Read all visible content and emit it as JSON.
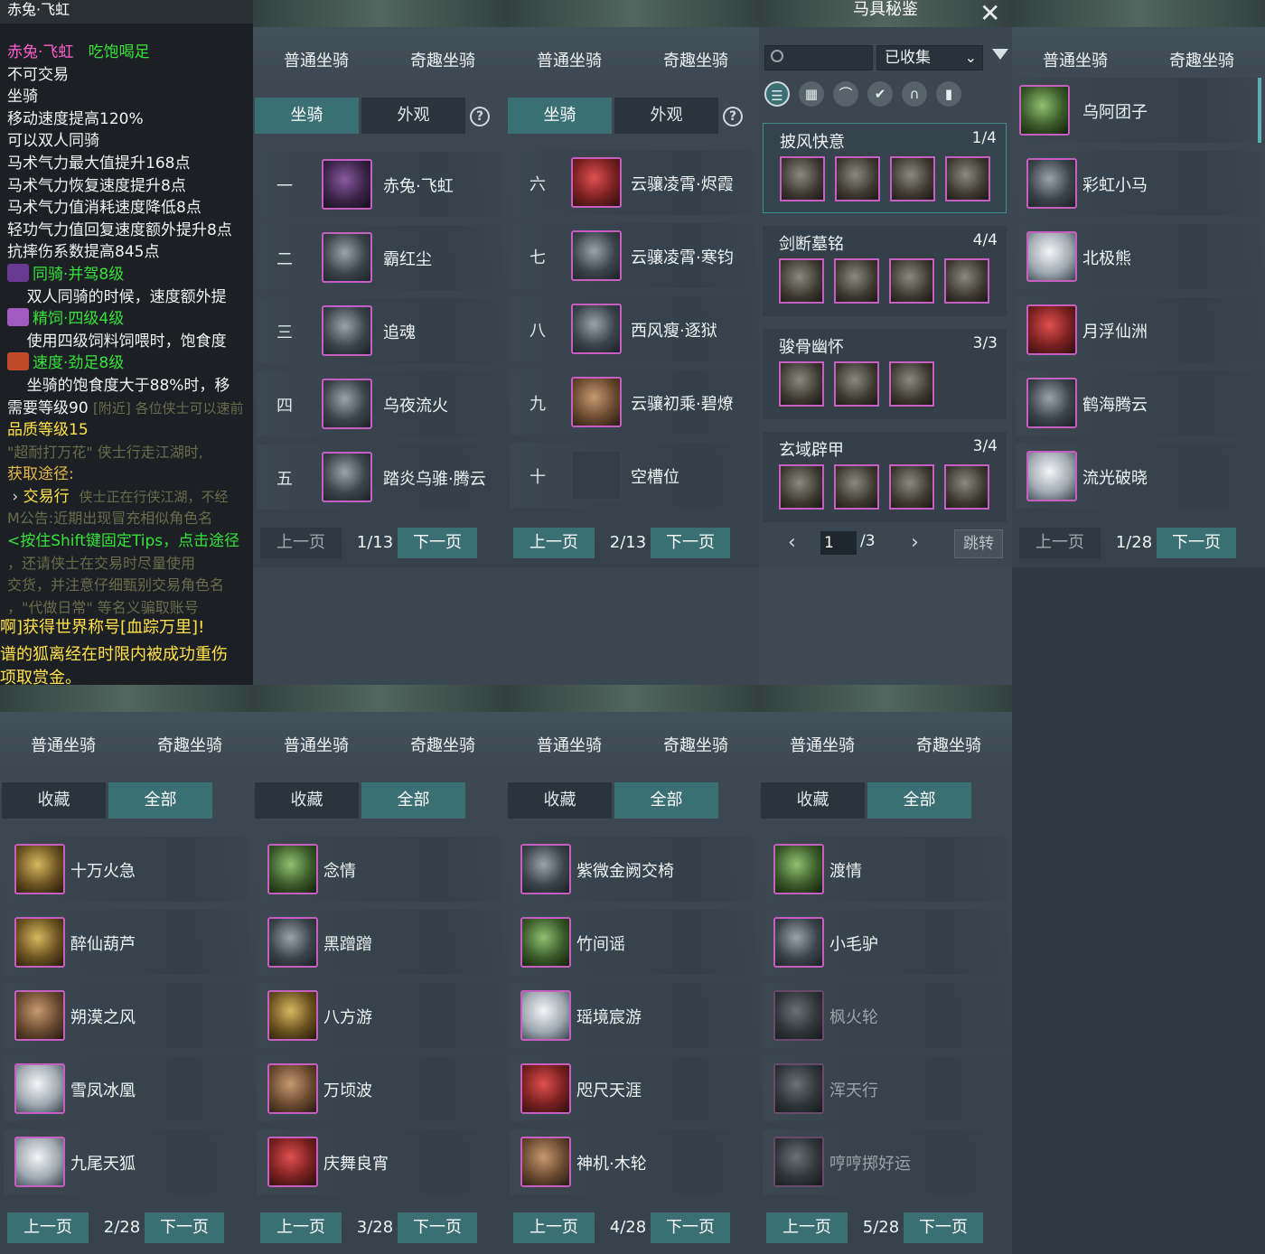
{
  "tooltip": {
    "header": "赤兔·飞虹",
    "name": "赤兔·飞虹",
    "state": "吃饱喝足",
    "trade": "不可交易",
    "kind": "坐骑",
    "lines": [
      "移动速度提高120%",
      "可以双人同骑",
      "马术气力最大值提升168点",
      "马术气力恢复速度提升8点",
      "马术气力值消耗速度降低8点",
      "轻功气力值回复速度额外提升8点",
      "抗摔伤系数提高845点"
    ],
    "skills": [
      {
        "name": "同骑·并驾8级",
        "desc": "双人同骑的时候，速度额外提"
      },
      {
        "name": "精饲·四级4级",
        "desc": "使用四级饲料饲喂时，饱食度"
      },
      {
        "name": "速度·劲足8级",
        "desc": "坐骑的饱食度大于88%时，移"
      }
    ],
    "level_req": "需要等级90",
    "quality": "品质等级15",
    "source_label": "获取途径:",
    "source": "交易行",
    "hint": "<按住Shift键固定Tips，点击途径",
    "chat1": "啊]获得世界称号[血踪万里]!",
    "chat2": "谱的狐离经在时限内被成功重伤",
    "chat3": "项取赏金。",
    "bg_chat": [
      "[附近] 各位侠士可以速前",
      "\"超耐打万花\" 侠士行走江湖时,",
      "交易行",
      "侠士正在行侠江湖，不经",
      "M公告:近期出现冒充相似角色名",
      "，还请侠士在交易时尽量使用",
      "交货，并注意仔细甄别交易角色名",
      "，\"代做日常\" 等名义骗取账号"
    ]
  },
  "tabs": {
    "normal": "普通坐骑",
    "fun": "奇趣坐骑"
  },
  "seg": {
    "mount": "坐骑",
    "look": "外观",
    "help": "?",
    "fav": "收藏",
    "all": "全部"
  },
  "pager": {
    "prev": "上一页",
    "next": "下一页"
  },
  "panel1": {
    "page": "1/13",
    "rows": [
      {
        "num": "一",
        "name": "赤兔·飞虹",
        "icon": "horse-icon"
      },
      {
        "num": "二",
        "name": "霸红尘",
        "icon": "horse-icon"
      },
      {
        "num": "三",
        "name": "追魂",
        "icon": "horse-icon"
      },
      {
        "num": "四",
        "name": "乌夜流火",
        "icon": "horse-icon"
      },
      {
        "num": "五",
        "name": "踏炎乌骓·腾云",
        "icon": "horse-icon"
      }
    ]
  },
  "panel2": {
    "page": "2/13",
    "rows": [
      {
        "num": "六",
        "name": "云骧凌霄·烬霞",
        "icon": "horse-icon"
      },
      {
        "num": "七",
        "name": "云骧凌霄·寒钧",
        "icon": "horse-icon"
      },
      {
        "num": "八",
        "name": "西风瘦·逐狱",
        "icon": "horse-icon"
      },
      {
        "num": "九",
        "name": "云骧初乘·碧燎",
        "icon": "horse-icon"
      },
      {
        "num": "十",
        "name": "空槽位",
        "icon": "empty-slot-icon"
      }
    ]
  },
  "codex": {
    "title": "马具秘鉴",
    "close": "✕",
    "search_placeholder": "",
    "filter_value": "已收集",
    "sets": [
      {
        "name": "披风快意",
        "count": "1/4",
        "pieces": 4
      },
      {
        "name": "剑断墓铭",
        "count": "4/4",
        "pieces": 4
      },
      {
        "name": "骏骨幽怀",
        "count": "3/3",
        "pieces": 3
      },
      {
        "name": "玄域辟甲",
        "count": "3/4",
        "pieces": 4
      }
    ],
    "page_input": "1",
    "page_total": "/3",
    "jump": "跳转"
  },
  "panel4": {
    "page": "1/28",
    "rows": [
      "乌阿团子",
      "彩虹小马",
      "北极熊",
      "月浮仙洲",
      "鹤海腾云",
      "流光破晓"
    ]
  },
  "panel5": {
    "page": "2/28",
    "rows": [
      "十万火急",
      "醉仙葫芦",
      "朔漠之风",
      "雪凤冰凰",
      "九尾天狐"
    ]
  },
  "panel6": {
    "page": "3/28",
    "rows": [
      "念情",
      "黑蹭蹭",
      "八方游",
      "万顷波",
      "庆舞良宵"
    ]
  },
  "panel7": {
    "page": "4/28",
    "rows": [
      "紫微金阙交椅",
      "竹间谣",
      "瑶境宸游",
      "咫尺天涯",
      "神机·木轮"
    ]
  },
  "panel8": {
    "page": "5/28",
    "rows": [
      "渡情",
      "小毛驴",
      "枫火轮",
      "浑天行",
      "哼哼掷好运"
    ]
  }
}
